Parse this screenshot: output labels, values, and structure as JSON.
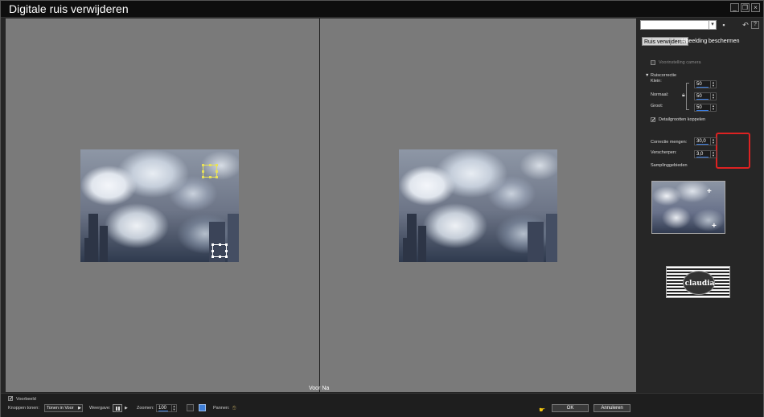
{
  "window": {
    "title": "Digitale ruis verwijderen",
    "controls": [
      "_",
      "❐",
      "×"
    ]
  },
  "preview": {
    "divider_label": "Voor Na"
  },
  "panel": {
    "preset_value": "",
    "tabs": [
      {
        "label": "Ruis verwijderen",
        "active": true
      },
      {
        "label": "Afbeelding beschermen",
        "active": false
      }
    ],
    "camera_preset_label": "Voorinstelling camera",
    "noise_section_label": "Ruiscorrectie",
    "small_label": "Klein:",
    "small_value": "50",
    "normal_label": "Normaal:",
    "normal_value": "50",
    "large_label": "Groot:",
    "large_value": "50",
    "link_label": "Detailgrootten koppelen",
    "blend_label": "Correctie mengen:",
    "blend_value": "30,0",
    "sharpen_label": "Verscherpen:",
    "sharpen_value": "3,0",
    "sample_label": "Samplinggebieden",
    "logo_text": "claudia"
  },
  "bottom": {
    "preview_label": "Voorbeeld",
    "buttons_label": "Knoppen tonen:",
    "buttons_value": "Tonen in Voor",
    "view_label": "Weergave:",
    "zoom_label": "Zoomen:",
    "zoom_value": "100",
    "pan_label": "Pannen:",
    "ok_label": "OK",
    "cancel_label": "Annuleren"
  },
  "colors": {
    "accent": "#3b7de0",
    "highlight": "#dd2222",
    "preview_bg": "#7a7a7a",
    "panel_bg": "#262626"
  }
}
